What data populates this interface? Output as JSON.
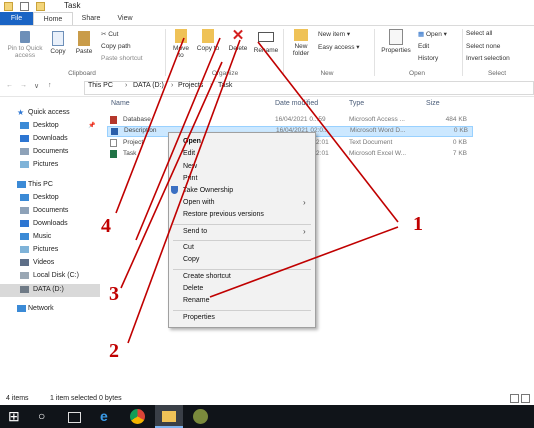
{
  "window": {
    "title": "Task"
  },
  "tabs": [
    "File",
    "Home",
    "Share",
    "View"
  ],
  "ribbon": {
    "clipboard": {
      "label": "Clipboard",
      "pin": "Pin to Quick\naccess",
      "copy": "Copy",
      "paste": "Paste",
      "cut": "Cut",
      "copy_path": "Copy path",
      "paste_shortcut": "Paste shortcut"
    },
    "organize": {
      "label": "Organize",
      "move_to": "Move to",
      "copy_to": "Copy to",
      "delete": "Delete",
      "rename": "Rename"
    },
    "new": {
      "label": "New",
      "new_folder": "New folder",
      "new_item": "New item",
      "easy_access": "Easy access"
    },
    "open": {
      "label": "Open",
      "properties": "Properties",
      "open": "Open",
      "edit": "Edit",
      "history": "History"
    },
    "select": {
      "label": "Select",
      "select_all": "Select all",
      "select_none": "Select none",
      "invert_selection": "Invert selection"
    }
  },
  "address": {
    "this_pc": "This PC",
    "drive": "DATA (D:)",
    "projects": "Projects",
    "task": "Task"
  },
  "nav": {
    "quick_access": "Quick access",
    "quick_items": [
      "Desktop",
      "Downloads",
      "Documents",
      "Pictures"
    ],
    "this_pc": "This PC",
    "pc_items": [
      "Desktop",
      "Documents",
      "Downloads",
      "Music",
      "Pictures",
      "Videos",
      "Local Disk (C:)",
      "DATA (D:)"
    ],
    "network": "Network"
  },
  "columns": {
    "name": "Name",
    "date": "Date modified",
    "type": "Type",
    "size": "Size"
  },
  "files": [
    {
      "name": "Database",
      "date": "16/04/2021 0...59",
      "type": "Microsoft Access ...",
      "size": "484 KB"
    },
    {
      "name": "Description",
      "date": "16/04/2021 02:0...",
      "type": "Microsoft Word D...",
      "size": "0 KB"
    },
    {
      "name": "Project",
      "date": "...02:01",
      "type": "Text Document",
      "size": "0 KB"
    },
    {
      "name": "Task",
      "date": "...02:01",
      "type": "Microsoft Excel W...",
      "size": "7 KB"
    }
  ],
  "context_menu": {
    "open": "Open",
    "edit": "Edit",
    "new": "New",
    "print": "Print",
    "take_ownership": "Take Ownership",
    "open_with": "Open with",
    "restore": "Restore previous versions",
    "send_to": "Send to",
    "cut": "Cut",
    "copy": "Copy",
    "create_shortcut": "Create shortcut",
    "delete": "Delete",
    "rename": "Rename",
    "properties": "Properties"
  },
  "status": {
    "items": "4 items",
    "selected": "1 item selected  0 bytes"
  },
  "annotations": {
    "n1": "1",
    "n2": "2",
    "n3": "3",
    "n4": "4"
  },
  "colors": {
    "accent": "#1a64c4",
    "annotation": "#c00000",
    "selection": "#cce8ff",
    "taskbar": "#101419"
  }
}
